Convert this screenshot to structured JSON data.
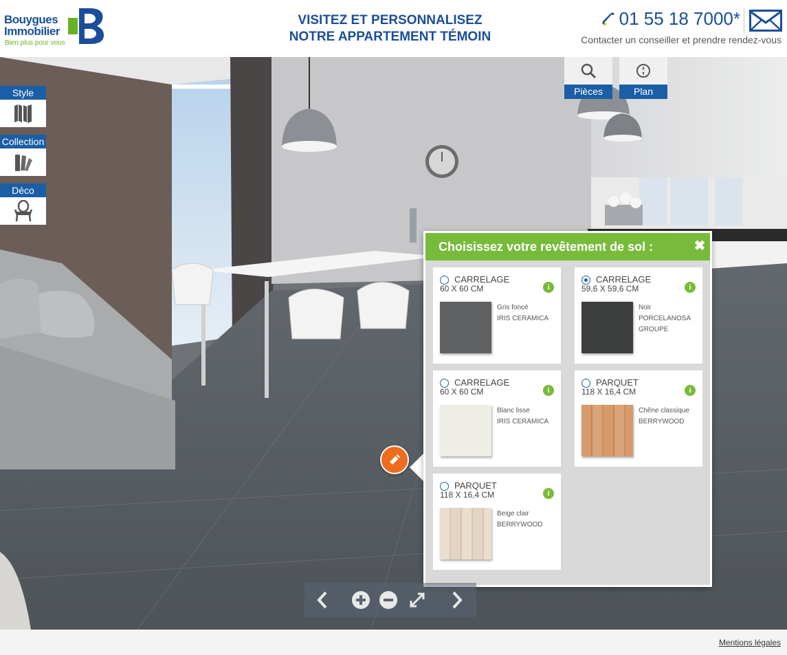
{
  "brand": {
    "line1": "Bouygues",
    "line2": "Immobilier",
    "tagline": "Bien plus pour vous",
    "logo_icon": "bouygues-logo",
    "accent": "#1a4e9a",
    "green": "#6ab023"
  },
  "header": {
    "headline_line1": "VISITEZ ET PERSONNALISEZ",
    "headline_line2": "NOTRE APPARTEMENT TÉMOIN",
    "phone": "01 55 18 7000*",
    "contact_text": "Contacter un conseiller et prendre rendez-vous",
    "phone_icon": "phone-icon",
    "mail_icon": "mail-icon"
  },
  "left_toolbar": [
    {
      "label": "Style",
      "icon": "book-icon"
    },
    {
      "label": "Collection",
      "icon": "swatches-icon"
    },
    {
      "label": "Déco",
      "icon": "chair-icon"
    }
  ],
  "top_buttons": [
    {
      "label": "Pièces",
      "icon": "search-icon"
    },
    {
      "label": "Plan",
      "icon": "compass-icon"
    }
  ],
  "panel": {
    "title": "Choisissez votre revêtement de sol :",
    "close_icon": "close-icon",
    "options": [
      {
        "type": "CARRELAGE",
        "size": "60 X 60 CM",
        "name": "Gris foncé",
        "brand": "IRIS CERAMICA",
        "selected": false,
        "swatch_color": "#5f6163"
      },
      {
        "type": "CARRELAGE",
        "size": "59,6 X 59,6 CM",
        "name": "Noir",
        "brand": "PORCELANOSA",
        "brand2": "GROUPE",
        "selected": true,
        "swatch_color": "#3c3e3e"
      },
      {
        "type": "CARRELAGE",
        "size": "60 X 60 CM",
        "name": "Blanc lisse",
        "brand": "IRIS CERAMICA",
        "selected": false,
        "swatch_color": "#efeee6"
      },
      {
        "type": "PARQUET",
        "size": "118 X 16,4 CM",
        "name": "Chêne classique",
        "brand": "BERRYWOOD",
        "selected": false,
        "swatch_color": "#d49368"
      },
      {
        "type": "PARQUET",
        "size": "118 X 16,4 CM",
        "name": "Beige clair",
        "brand": "BERRYWOOD",
        "selected": false,
        "swatch_color": "#e6d8c3"
      }
    ]
  },
  "bottom_nav": [
    {
      "icon": "chevron-left-icon"
    },
    {
      "icon": "zoom-in-icon"
    },
    {
      "icon": "zoom-out-icon"
    },
    {
      "icon": "fullscreen-icon"
    },
    {
      "icon": "chevron-right-icon"
    }
  ],
  "footer": {
    "legal": "Mentions légales"
  }
}
